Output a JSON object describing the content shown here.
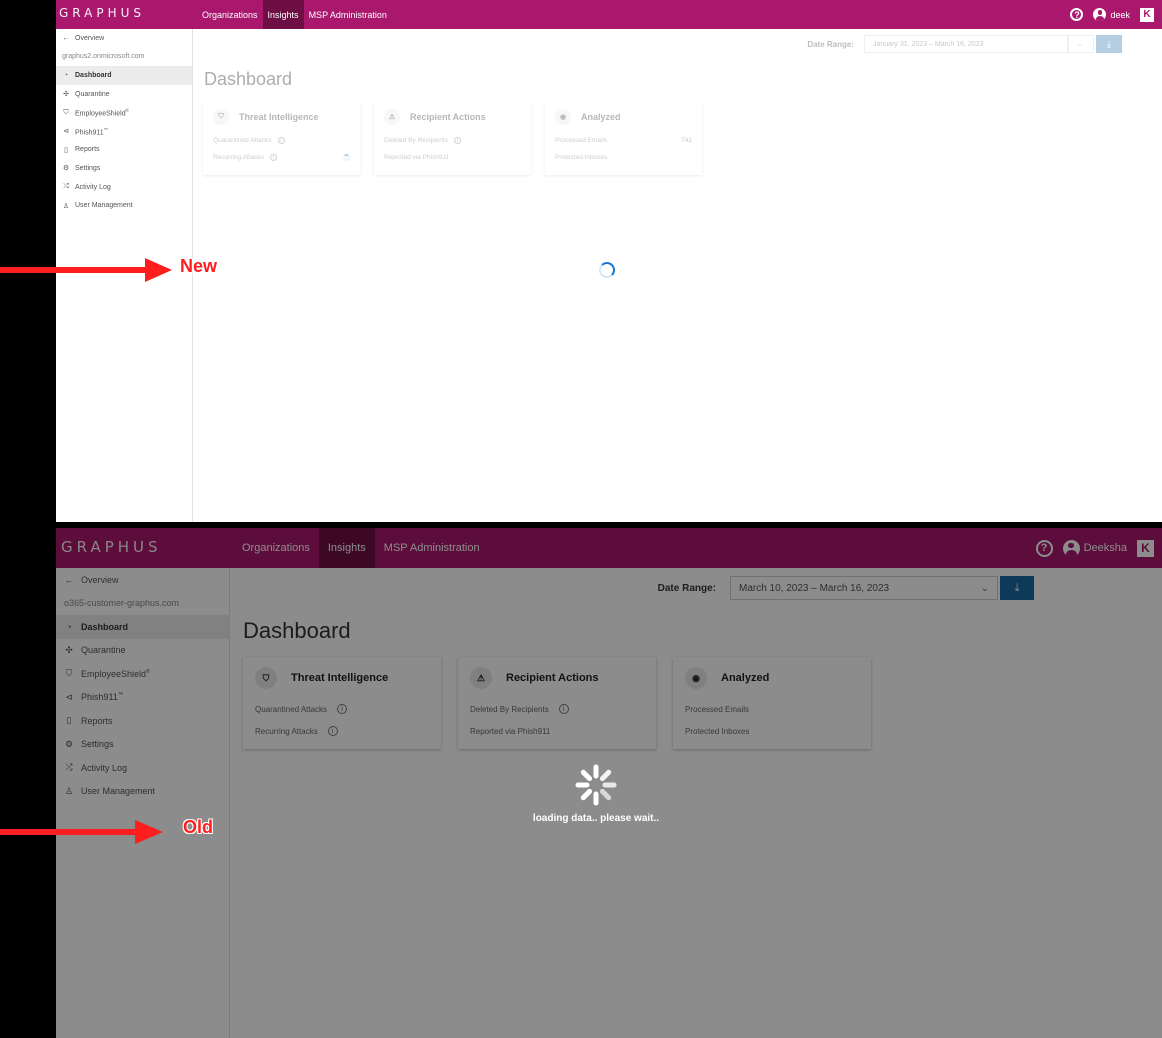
{
  "new": {
    "logo": "GRAPHUS",
    "nav": [
      {
        "label": "Organizations"
      },
      {
        "label": "Insights"
      },
      {
        "label": "MSP Administration"
      }
    ],
    "user_name": "deek",
    "k_logo": "K",
    "sidebar": {
      "back": "Overview",
      "tenant": "graphus2.onmicrosoft.com",
      "items": [
        {
          "label": "Dashboard",
          "icon": "dashboard-icon"
        },
        {
          "label": "Quarantine",
          "icon": "quarantine-icon"
        },
        {
          "label": "EmployeeShield",
          "sup": "®",
          "icon": "shield-icon"
        },
        {
          "label": "Phish911",
          "sup": "™",
          "icon": "phish-icon"
        },
        {
          "label": "Reports",
          "icon": "report-icon"
        },
        {
          "label": "Settings",
          "icon": "gear-icon"
        },
        {
          "label": "Activity Log",
          "icon": "shuffle-icon"
        },
        {
          "label": "User Management",
          "icon": "user-icon"
        }
      ]
    },
    "date_label": "Date Range:",
    "date_value": "January 31, 2023  –  March 16, 2023",
    "title": "Dashboard",
    "cards": [
      {
        "title": "Threat Intelligence",
        "rows": [
          "Quarantined Attacks",
          "Recurring Attacks"
        ]
      },
      {
        "title": "Recipient Actions",
        "rows": [
          "Deleted By Recipients",
          "Reported via Phish911"
        ]
      },
      {
        "title": "Analyzed",
        "rows": [
          "Processed Emails",
          "Protected Inboxes"
        ],
        "value": "742"
      }
    ]
  },
  "old": {
    "logo": "GRAPHUS",
    "nav": [
      {
        "label": "Organizations"
      },
      {
        "label": "Insights"
      },
      {
        "label": "MSP Administration"
      }
    ],
    "user_name": "Deeksha",
    "k_logo": "K",
    "sidebar": {
      "back": "Overview",
      "tenant": "o365-customer-graphus.com",
      "items": [
        {
          "label": "Dashboard"
        },
        {
          "label": "Quarantine"
        },
        {
          "label": "EmployeeShield",
          "sup": "®"
        },
        {
          "label": "Phish911",
          "sup": "™"
        },
        {
          "label": "Reports"
        },
        {
          "label": "Settings"
        },
        {
          "label": "Activity Log"
        },
        {
          "label": "User Management"
        }
      ]
    },
    "date_label": "Date Range:",
    "date_value": "March 10, 2023  –  March 16, 2023",
    "title": "Dashboard",
    "cards": [
      {
        "title": "Threat Intelligence",
        "rows": [
          "Quarantined Attacks",
          "Recurring Attacks"
        ]
      },
      {
        "title": "Recipient Actions",
        "rows": [
          "Deleted By Recipients",
          "Reported via Phish911"
        ]
      },
      {
        "title": "Analyzed",
        "rows": [
          "Processed Emails",
          "Protected Inboxes"
        ]
      }
    ],
    "loading_text": "loading data.. please wait.."
  },
  "annotations": {
    "new_label": "New",
    "old_label": "Old",
    "color": "#ff1e1e"
  },
  "colors": {
    "brand": "#a9186d",
    "nav_active": "#6d0f45",
    "accent_blue": "#1b6aa5"
  }
}
